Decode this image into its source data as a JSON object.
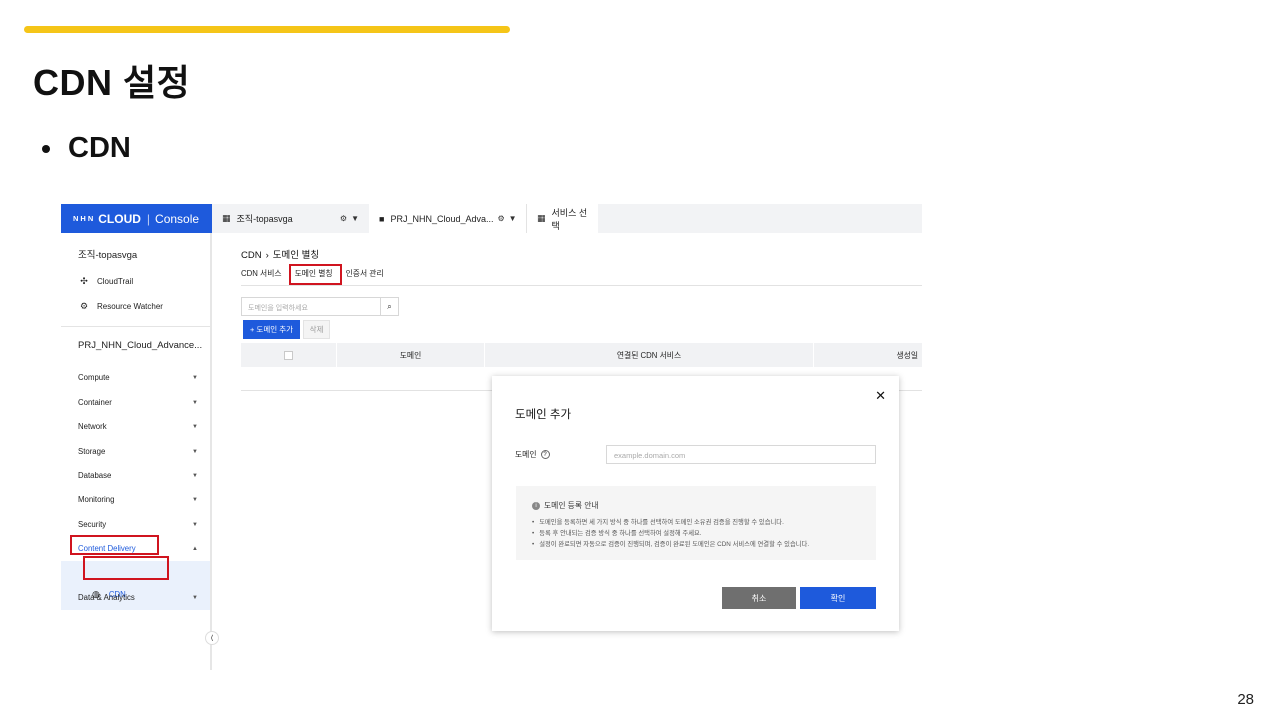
{
  "slide": {
    "title": "CDN 설정",
    "bullet": "CDN",
    "page_number": "28",
    "accent_color": "#f5c518"
  },
  "console": {
    "brand": {
      "nhn": "NHN",
      "cloud": "CLOUD",
      "console": "Console",
      "color": "#1e5adc"
    },
    "topnav": {
      "org_tab": {
        "icon": "building-icon",
        "label": "조직-topasvga"
      },
      "project_tab": {
        "icon": "folder-icon",
        "label": "PRJ_NHN_Cloud_Adva..."
      },
      "service_tab": {
        "icon": "grid-icon",
        "label": "서비스 선택"
      }
    },
    "sidebar": {
      "org_name": "조직-topasvga",
      "links": [
        {
          "icon": "cloudtrail-icon",
          "label": "CloudTrail"
        },
        {
          "icon": "resource-watcher-icon",
          "label": "Resource Watcher"
        }
      ],
      "project_name": "PRJ_NHN_Cloud_Advance...",
      "categories": [
        "Compute",
        "Container",
        "Network",
        "Storage",
        "Database",
        "Monitoring",
        "Security",
        "Content Delivery",
        "Data & Analytics"
      ],
      "active_category": "Content Delivery",
      "active_item": "CDN"
    },
    "main": {
      "breadcrumb": {
        "root": "CDN",
        "current": "도메인 별칭"
      },
      "tabs": [
        "CDN 서비스",
        "도메인 별칭",
        "인증서 관리"
      ],
      "search_placeholder": "도메인을 입력하세요",
      "add_button": "+ 도메인 추가",
      "delete_button": "삭제",
      "table_headers": [
        "도메인",
        "연결된 CDN 서비스",
        "생성일"
      ]
    },
    "modal": {
      "title": "도메인 추가",
      "field_label": "도메인",
      "field_placeholder": "example.domain.com",
      "info_title": "도메인 등록 안내",
      "info_items": [
        "도메인을 등록하면 세 가지 방식 중 하나를 선택하여 도메인 소유권 검증을 진행할 수 있습니다.",
        "등록 후 안내되는 검증 방식 중 하나를 선택하여 설정해 주세요.",
        "설정이 완료되면 자동으로 검증이 진행되며, 검증이 완료된 도메인은 CDN 서비스에 연결할 수 있습니다."
      ],
      "cancel_button": "취소",
      "confirm_button": "확인"
    }
  }
}
